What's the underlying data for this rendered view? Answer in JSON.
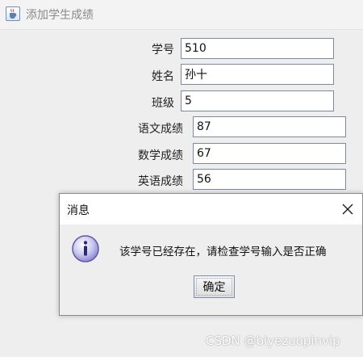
{
  "window": {
    "title": "添加学生成绩",
    "icon": "java-cup-icon"
  },
  "form": {
    "student_id_label": "学号",
    "student_id_value": "510",
    "name_label": "姓名",
    "name_value": "孙十",
    "class_label": "班级",
    "class_value": "5",
    "chinese_label": "语文成绩",
    "chinese_value": "87",
    "math_label": "数学成绩",
    "math_value": "67",
    "english_label": "英语成绩",
    "english_value": "56"
  },
  "dialog": {
    "title": "消息",
    "icon": "info-icon",
    "close_icon": "close-icon",
    "message": "该学号已经存在，请检查学号输入是否正确",
    "ok_label": "确定"
  },
  "watermark": "CSDN @biyezuopinvip"
}
